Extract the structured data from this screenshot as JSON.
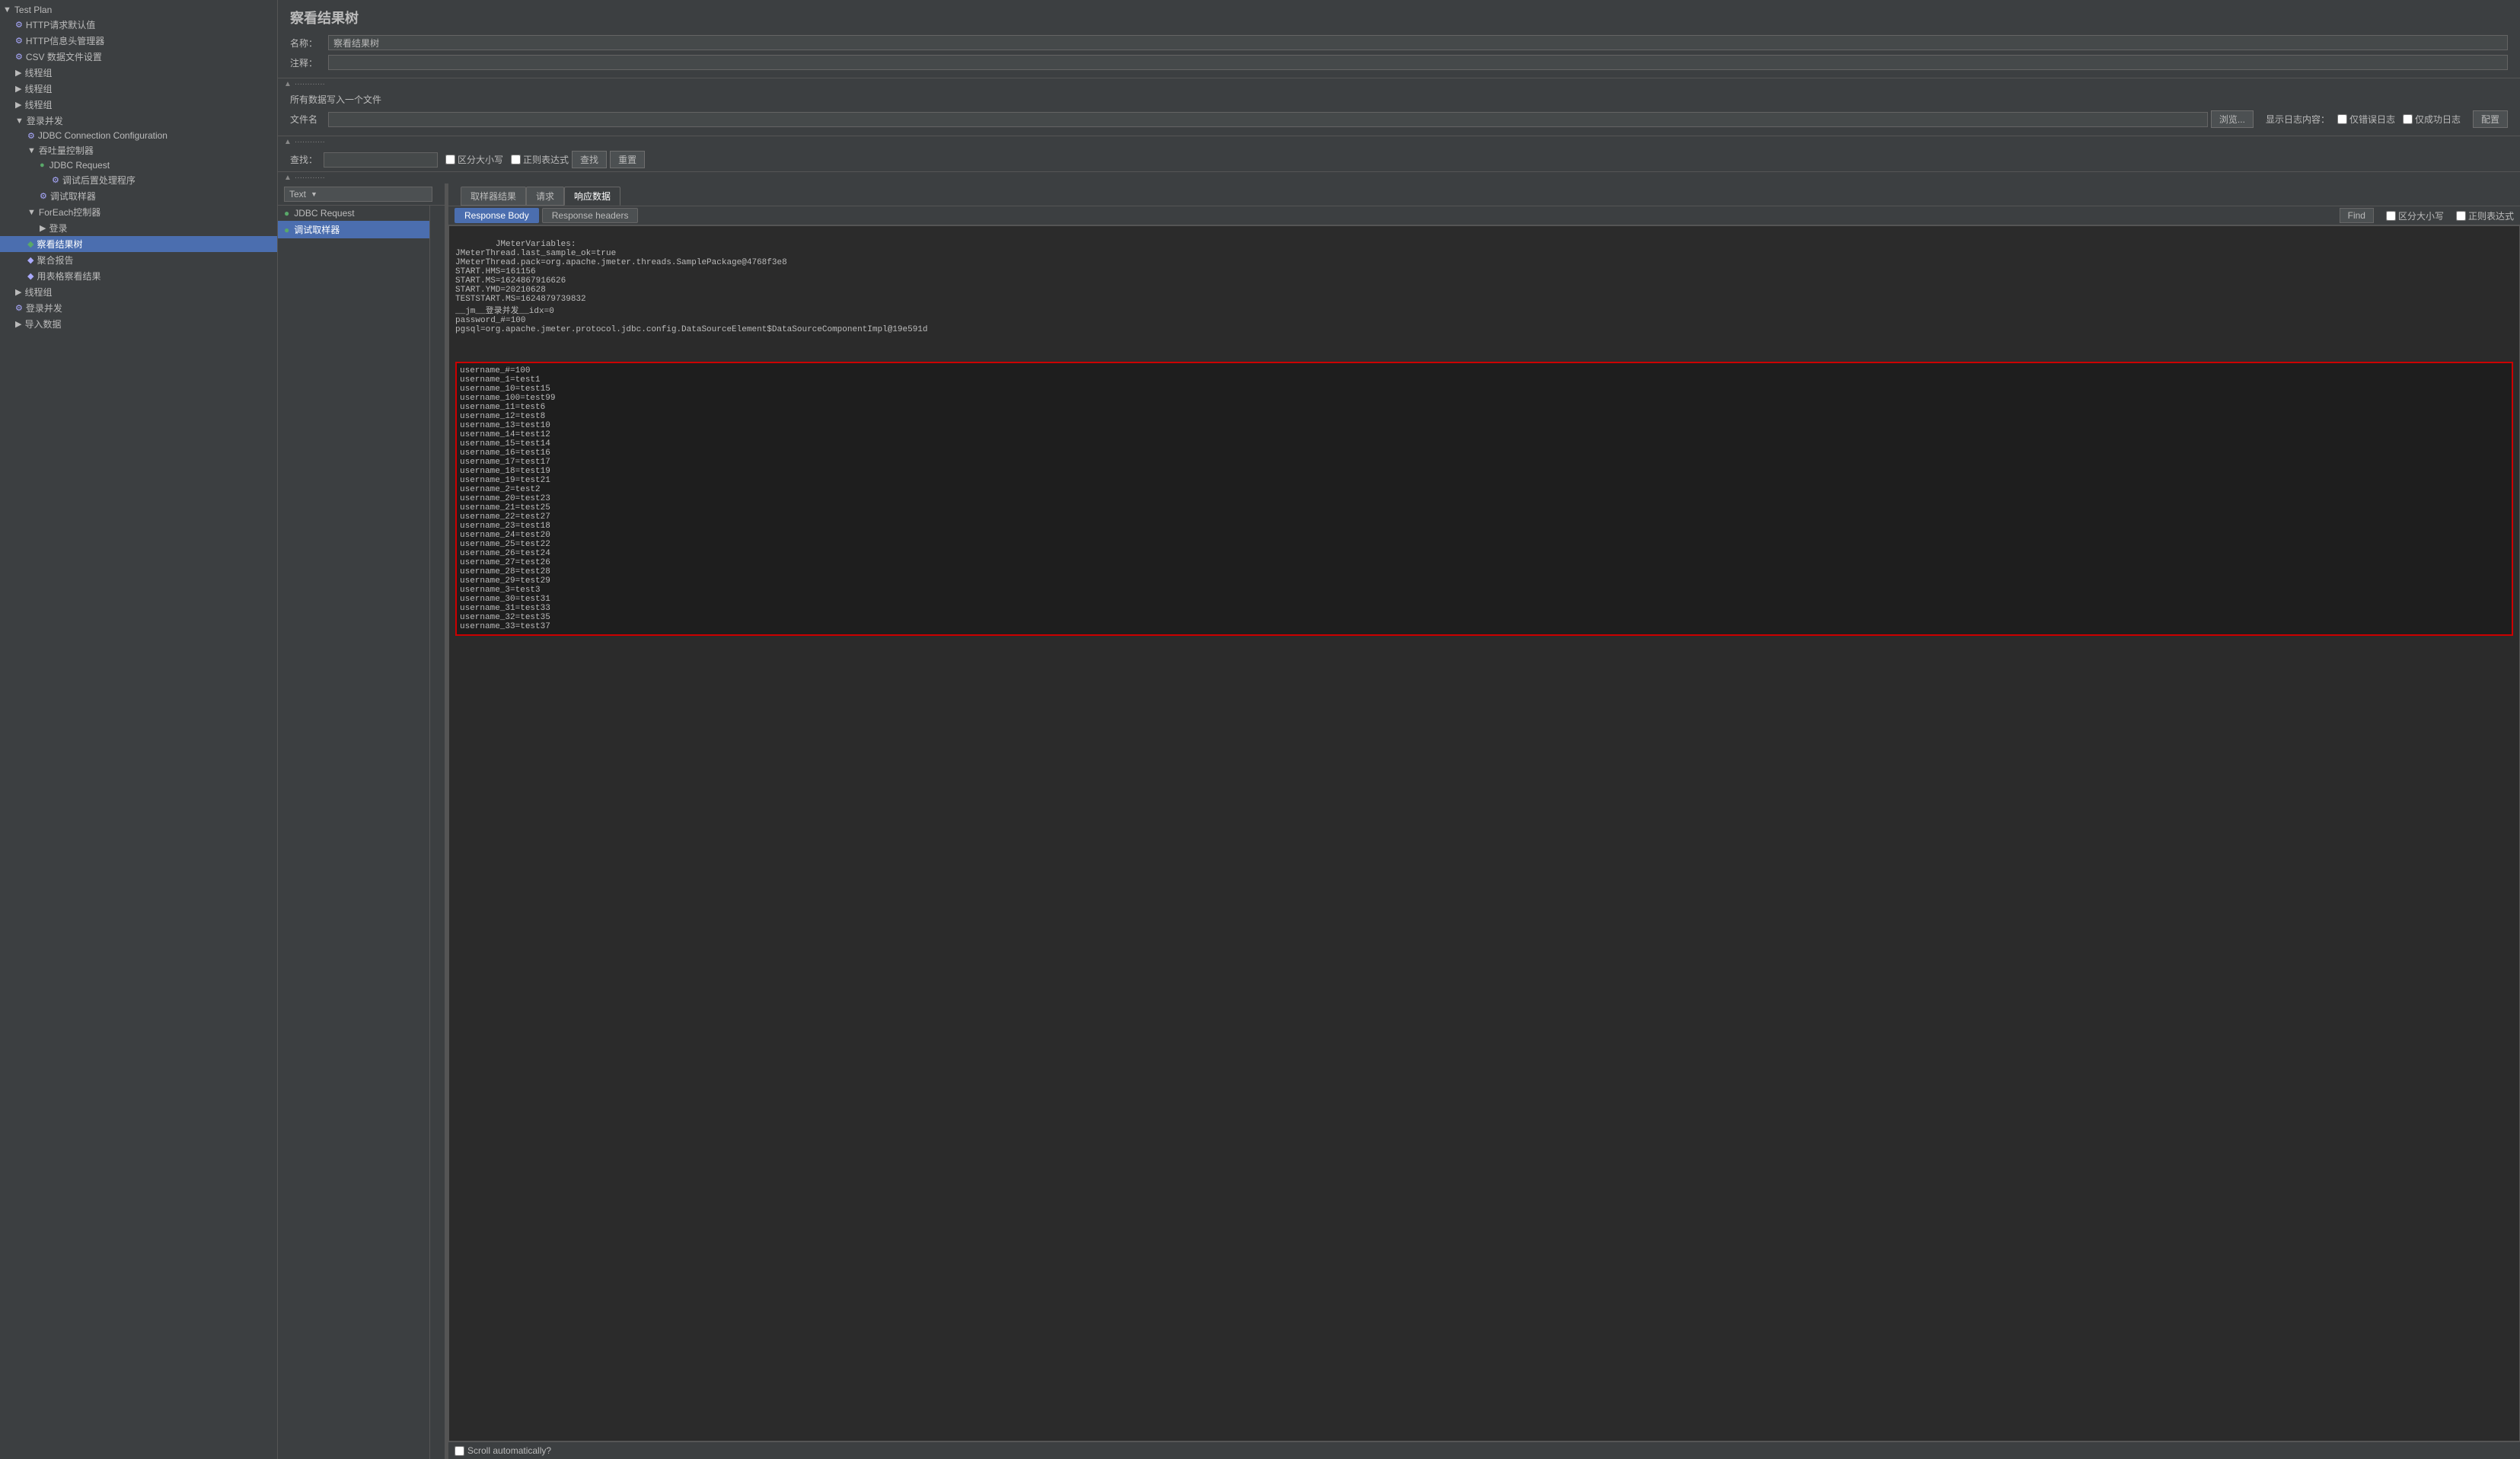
{
  "app": {
    "title": "察看结果树"
  },
  "sidebar": {
    "items": [
      {
        "id": "test-plan",
        "label": "Test Plan",
        "indent": 0,
        "icon": "▲",
        "type": "root",
        "expanded": true
      },
      {
        "id": "http-defaults",
        "label": "HTTP请求默认值",
        "indent": 1,
        "icon": "⚙",
        "type": "config"
      },
      {
        "id": "http-header",
        "label": "HTTP信息头管理器",
        "indent": 1,
        "icon": "⚙",
        "type": "config"
      },
      {
        "id": "csv-data",
        "label": "CSV 数据文件设置",
        "indent": 1,
        "icon": "⚙",
        "type": "config"
      },
      {
        "id": "thread-group-1",
        "label": "线程组",
        "indent": 1,
        "icon": "▶",
        "type": "thread",
        "expanded": false
      },
      {
        "id": "thread-group-2",
        "label": "线程组",
        "indent": 1,
        "icon": "▶",
        "type": "thread",
        "expanded": false
      },
      {
        "id": "thread-group-3",
        "label": "线程组",
        "indent": 1,
        "icon": "▶",
        "type": "thread",
        "expanded": false
      },
      {
        "id": "login-dev",
        "label": "登录并发",
        "indent": 1,
        "icon": "▼",
        "type": "thread",
        "expanded": true
      },
      {
        "id": "jdbc-config",
        "label": "JDBC Connection Configuration",
        "indent": 2,
        "icon": "⚙",
        "type": "config"
      },
      {
        "id": "swallow",
        "label": "吞吐量控制器",
        "indent": 2,
        "icon": "▼",
        "type": "controller",
        "expanded": true
      },
      {
        "id": "jdbc-request",
        "label": "JDBC Request",
        "indent": 3,
        "icon": "▶",
        "type": "sampler"
      },
      {
        "id": "post-processor",
        "label": "调试后置处理程序",
        "indent": 4,
        "icon": "⚙",
        "type": "config"
      },
      {
        "id": "debug-sampler",
        "label": "调试取样器",
        "indent": 3,
        "icon": "⚙",
        "type": "sampler"
      },
      {
        "id": "foreach-ctrl",
        "label": "ForEach控制器",
        "indent": 2,
        "icon": "▼",
        "type": "controller",
        "expanded": true
      },
      {
        "id": "login",
        "label": "登录",
        "indent": 3,
        "icon": "▶",
        "type": "sampler"
      },
      {
        "id": "result-tree",
        "label": "察看结果树",
        "indent": 2,
        "icon": "📊",
        "type": "listener",
        "selected": true
      },
      {
        "id": "summary",
        "label": "聚合报告",
        "indent": 2,
        "icon": "📊",
        "type": "listener"
      },
      {
        "id": "table-result",
        "label": "用表格察看结果",
        "indent": 2,
        "icon": "📊",
        "type": "listener"
      },
      {
        "id": "thread-group-4",
        "label": "线程组",
        "indent": 1,
        "icon": "▶",
        "type": "thread"
      },
      {
        "id": "login-dev-2",
        "label": "登录并发",
        "indent": 1,
        "icon": "▶",
        "type": "thread"
      },
      {
        "id": "import-data",
        "label": "导入数据",
        "indent": 1,
        "icon": "▶",
        "type": "sampler"
      }
    ]
  },
  "panel": {
    "title": "察看结果树",
    "name_label": "名称：",
    "name_value": "察看结果树",
    "comment_label": "注释：",
    "file_all_label": "所有数据写入一个文件",
    "filename_label": "文件名",
    "filename_value": "",
    "browse_btn": "浏览...",
    "log_content_label": "显示日志内容：",
    "error_log_label": "仅错误日志",
    "success_log_label": "仅成功日志",
    "config_btn": "配置",
    "search_label": "查找：",
    "search_placeholder": "",
    "case_sensitive_label": "区分大小写",
    "regex_label": "正则表达式",
    "find_btn": "查找",
    "reset_btn": "重置",
    "text_dropdown": "Text",
    "sample_tabs": {
      "results": "取样器结果",
      "request": "请求",
      "response": "响应数据"
    },
    "response_tabs": {
      "body": "Response Body",
      "headers": "Response headers"
    },
    "find_bar": {
      "find_btn": "Find",
      "case_label": "区分大小写",
      "regex_label": "正则表达式"
    },
    "scroll_auto": "Scroll automatically?"
  },
  "samples": [
    {
      "id": "jdbc-request",
      "label": "JDBC Request",
      "status": "ok"
    },
    {
      "id": "debug-sampler",
      "label": "调试取样器",
      "status": "ok",
      "selected": true
    }
  ],
  "response_content": {
    "pre_highlight": "JMeterVariables:\nJMeterThread.last_sample_ok=true\nJMeterThread.pack=org.apache.jmeter.threads.SamplePackage@4768f3e8\nSTART.HMS=161156\nSTART.MS=1624867916626\nSTART.YMD=20210628\nTESTSTART.MS=1624879739832\n__jm__登录并发__idx=0\npassword_#=100\npgsql=org.apache.jmeter.protocol.jdbc.config.DataSourceElement$DataSourceComponentImpl@19e591d",
    "highlighted": "username_#=100\nusername_1=test1\nusername_10=test15\nusername_100=test99\nusername_11=test6\nusername_12=test8\nusername_13=test10\nusername_14=test12\nusername_15=test14\nusername_16=test16\nusername_17=test17\nusername_18=test19\nusername_19=test21\nusername_2=test2\nusername_20=test23\nusername_21=test25\nusername_22=test27\nusername_23=test18\nusername_24=test20\nusername_25=test22\nusername_26=test24\nusername_27=test26\nusername_28=test28\nusername_29=test29\nusername_3=test3\nusername_30=test31\nusername_31=test33\nusername_32=test35\nusername_33=test37"
  },
  "colors": {
    "selected_bg": "#4b6eaf",
    "ok_green": "#59a869",
    "highlight_border": "#cc0000",
    "active_tab_bg": "#4b6eaf"
  }
}
